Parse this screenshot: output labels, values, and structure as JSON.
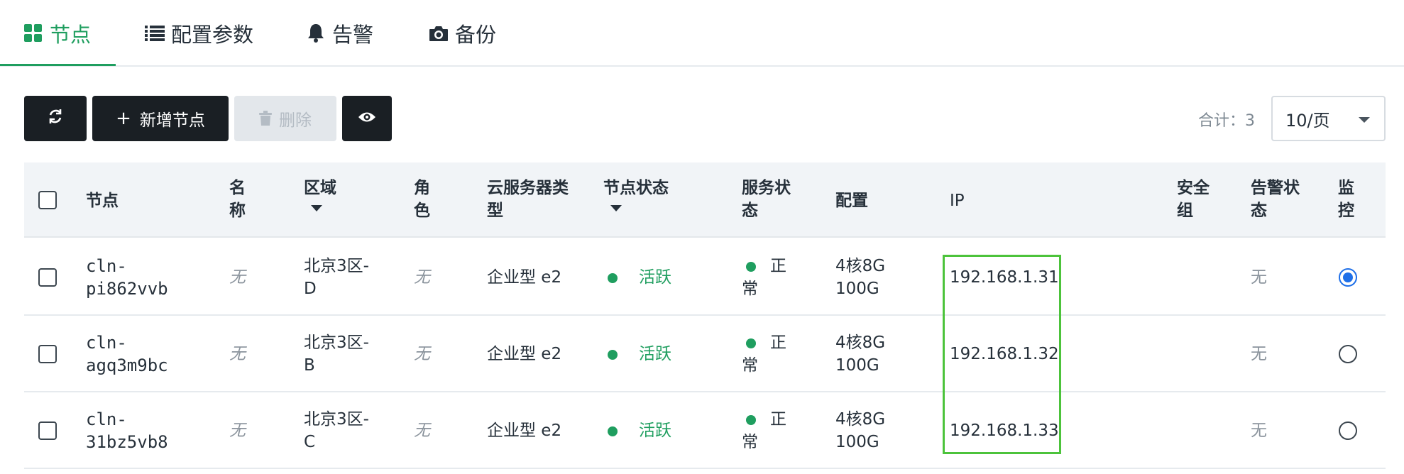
{
  "tabs": [
    {
      "label": "节点",
      "icon": "grid-icon",
      "active": true
    },
    {
      "label": "配置参数",
      "icon": "list-icon",
      "active": false
    },
    {
      "label": "告警",
      "icon": "bell-icon",
      "active": false
    },
    {
      "label": "备份",
      "icon": "camera-icon",
      "active": false
    }
  ],
  "toolbar": {
    "refresh_icon": "refresh-icon",
    "add_label": "新增节点",
    "delete_label": "删除",
    "view_icon": "eye-icon"
  },
  "pagination": {
    "total_label": "合计：3",
    "page_size": "10/页"
  },
  "table": {
    "headers": [
      "节点",
      "名称",
      "区域",
      "角色",
      "云服务器类型",
      "节点状态",
      "服务状态",
      "配置",
      "IP",
      "安全组",
      "告警状态",
      "监控"
    ],
    "header_lines": {
      "name": [
        "名",
        "称"
      ],
      "role": [
        "角",
        "色"
      ],
      "type": [
        "云服务器类",
        "型"
      ],
      "service": [
        "服务状",
        "态"
      ],
      "sg": [
        "安全",
        "组"
      ],
      "alarm": [
        "告警状",
        "态"
      ],
      "monitor": [
        "监",
        "控"
      ]
    },
    "rows": [
      {
        "node1": "cln-",
        "node2": "pi862vvb",
        "name": "无",
        "region1": "北京3区-",
        "region2": "D",
        "role": "无",
        "type": "企业型 e2",
        "status": "活跃",
        "svc1": "正",
        "svc2": "常",
        "cfg1": "4核8G",
        "cfg2": "100G",
        "ip": "192.168.1.31",
        "alarm": "无",
        "monitor_selected": true
      },
      {
        "node1": "cln-",
        "node2": "agq3m9bc",
        "name": "无",
        "region1": "北京3区-",
        "region2": "B",
        "role": "无",
        "type": "企业型 e2",
        "status": "活跃",
        "svc1": "正",
        "svc2": "常",
        "cfg1": "4核8G",
        "cfg2": "100G",
        "ip": "192.168.1.32",
        "alarm": "无",
        "monitor_selected": false
      },
      {
        "node1": "cln-",
        "node2": "31bz5vb8",
        "name": "无",
        "region1": "北京3区-",
        "region2": "C",
        "role": "无",
        "type": "企业型 e2",
        "status": "活跃",
        "svc1": "正",
        "svc2": "常",
        "cfg1": "4核8G",
        "cfg2": "100G",
        "ip": "192.168.1.33",
        "alarm": "无",
        "monitor_selected": false
      }
    ]
  },
  "colors": {
    "accent": "#1f9e5f",
    "dark_button": "#1a1f24",
    "highlight": "#4cc33b",
    "radio": "#1e6fe8"
  }
}
